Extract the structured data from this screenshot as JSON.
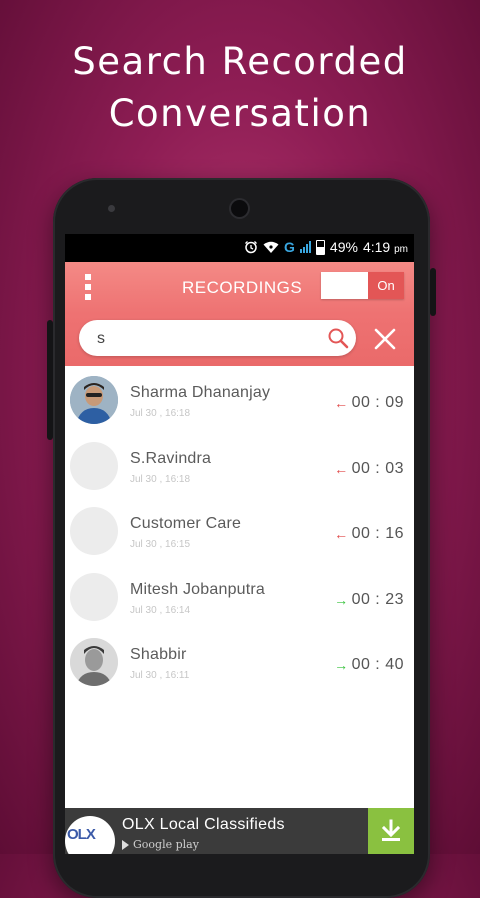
{
  "promo": {
    "line1": "Search Recorded",
    "line2": "Conversation"
  },
  "status": {
    "battery": "49%",
    "time": "4:19",
    "ampm": "pm",
    "network": "G"
  },
  "appbar": {
    "title": "RECORDINGS",
    "toggle_label": "On"
  },
  "search": {
    "value": "s",
    "placeholder": ""
  },
  "recordings": [
    {
      "name": "Sharma Dhananjay",
      "date": "Jul 30 , 16:18",
      "duration": "00 : 09",
      "direction": "incoming",
      "arrow": "←"
    },
    {
      "name": "S.Ravindra",
      "date": "Jul 30 , 16:18",
      "duration": "00 : 03",
      "direction": "incoming",
      "arrow": "←"
    },
    {
      "name": "Customer Care",
      "date": "Jul 30 , 16:15",
      "duration": "00 : 16",
      "direction": "incoming",
      "arrow": "←"
    },
    {
      "name": "Mitesh Jobanputra",
      "date": "Jul 30 , 16:14",
      "duration": "00 : 23",
      "direction": "outgoing",
      "arrow": "→"
    },
    {
      "name": "Shabbir",
      "date": "Jul 30 , 16:11",
      "duration": "00 : 40",
      "direction": "outgoing",
      "arrow": "→"
    }
  ],
  "ad": {
    "title": "OLX Local Classifieds",
    "store": "Google play",
    "logo_text": "OLX"
  },
  "colors": {
    "accent": "#ea6a6a",
    "incoming": "#e04848",
    "outgoing": "#37c23c",
    "download": "#8ac140"
  },
  "icons": {
    "menu": "overflow-menu-icon",
    "search": "search-icon",
    "close": "close-icon",
    "download": "download-icon",
    "alarm": "alarm-icon",
    "wifi": "wifi-icon",
    "signal": "signal-icon",
    "battery": "battery-icon"
  }
}
